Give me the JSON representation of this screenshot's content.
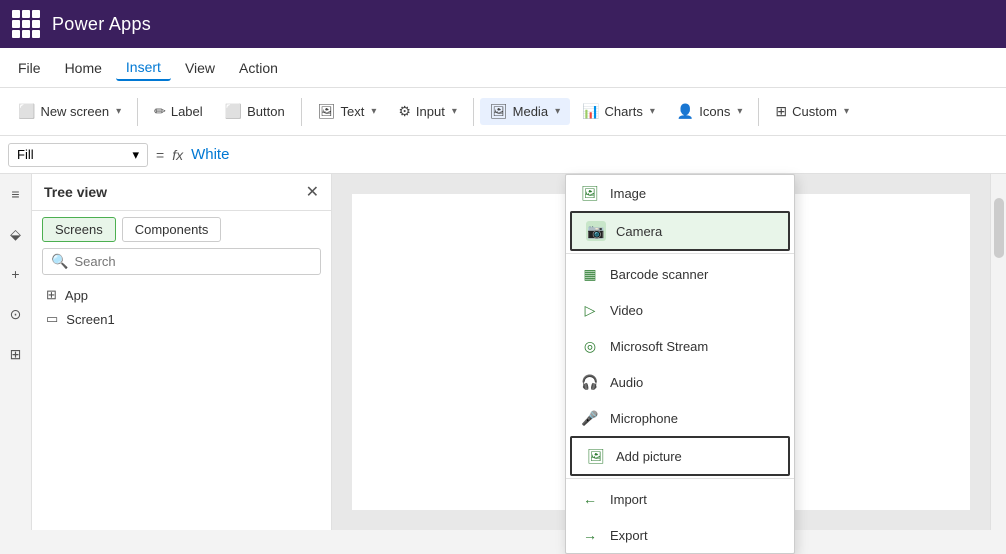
{
  "titleBar": {
    "appName": "Power Apps"
  },
  "menuBar": {
    "items": [
      {
        "id": "file",
        "label": "File"
      },
      {
        "id": "home",
        "label": "Home"
      },
      {
        "id": "insert",
        "label": "Insert",
        "active": true
      },
      {
        "id": "view",
        "label": "View"
      },
      {
        "id": "action",
        "label": "Action"
      }
    ]
  },
  "toolbar": {
    "newScreen": "New screen",
    "label": "Label",
    "button": "Button",
    "text": "Text",
    "input": "Input",
    "media": "Media",
    "charts": "Charts",
    "icons": "Icons",
    "custom": "Custom"
  },
  "formulaBar": {
    "selector": "Fill",
    "eq": "=",
    "fx": "fx",
    "value": "White"
  },
  "treeView": {
    "title": "Tree view",
    "tabs": [
      {
        "id": "screens",
        "label": "Screens",
        "active": true
      },
      {
        "id": "components",
        "label": "Components"
      }
    ],
    "searchPlaceholder": "Search",
    "items": [
      {
        "id": "app",
        "label": "App",
        "icon": "⊞"
      },
      {
        "id": "screen1",
        "label": "Screen1",
        "icon": "▭"
      }
    ]
  },
  "mediaDropdown": {
    "items": [
      {
        "id": "image",
        "label": "Image",
        "icon": "🖼",
        "highlighted": false
      },
      {
        "id": "camera",
        "label": "Camera",
        "icon": "📷",
        "highlighted": true,
        "bordered": true
      },
      {
        "id": "barcode",
        "label": "Barcode scanner",
        "icon": "▦"
      },
      {
        "id": "video",
        "label": "Video",
        "icon": "▷"
      },
      {
        "id": "stream",
        "label": "Microsoft Stream",
        "icon": "◎"
      },
      {
        "id": "audio",
        "label": "Audio",
        "icon": "🎧"
      },
      {
        "id": "microphone",
        "label": "Microphone",
        "icon": "🎤"
      },
      {
        "id": "addpicture",
        "label": "Add picture",
        "icon": "🖼+",
        "bordered": true
      },
      {
        "id": "import",
        "label": "Import",
        "icon": "←"
      },
      {
        "id": "export",
        "label": "Export",
        "icon": "→"
      }
    ]
  },
  "leftIcons": [
    "≡",
    "⬙",
    "+",
    "⊙",
    "⊞"
  ]
}
